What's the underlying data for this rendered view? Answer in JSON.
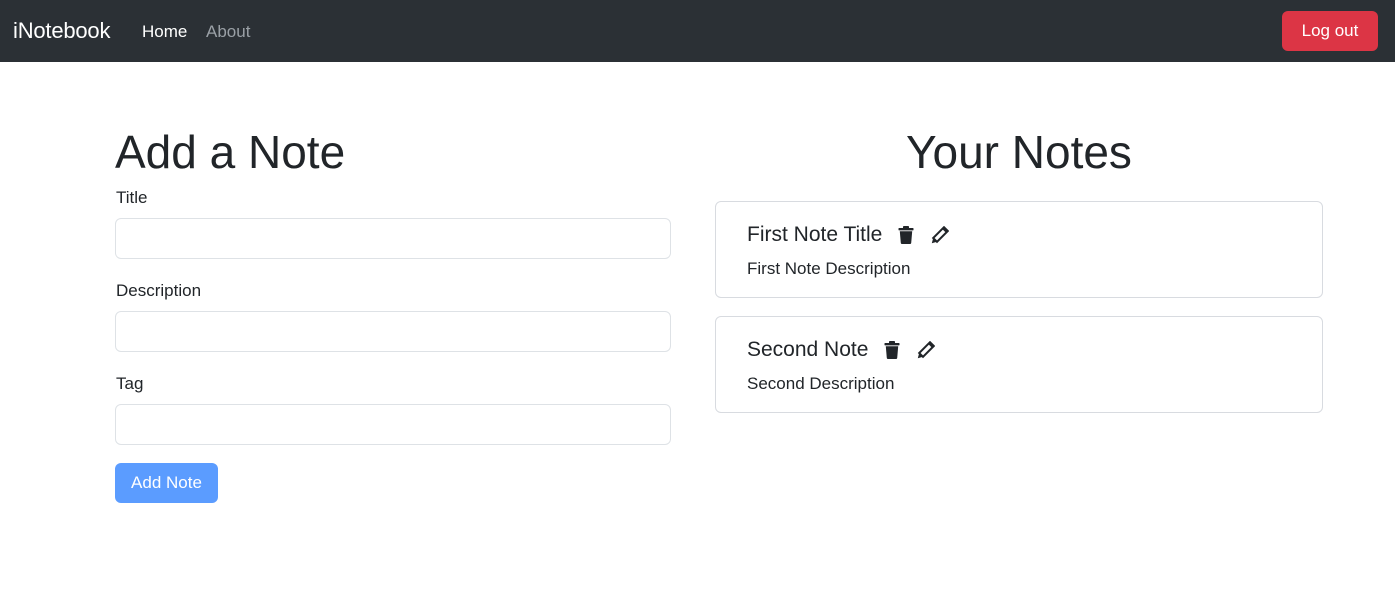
{
  "navbar": {
    "brand": "iNotebook",
    "links": [
      {
        "label": "Home"
      },
      {
        "label": "About"
      }
    ],
    "logout_label": "Log out"
  },
  "add_form": {
    "heading": "Add a Note",
    "fields": [
      {
        "label": "Title",
        "value": "",
        "placeholder": ""
      },
      {
        "label": "Description",
        "value": "",
        "placeholder": ""
      },
      {
        "label": "Tag",
        "value": "",
        "placeholder": ""
      }
    ],
    "submit_label": "Add Note"
  },
  "notes": {
    "heading": "Your Notes",
    "items": [
      {
        "title": "First Note Title",
        "description": "First Note Description",
        "icons": [
          "trash-icon",
          "pencil-icon"
        ]
      },
      {
        "title": "Second Note",
        "description": "Second Description",
        "icons": [
          "trash-icon",
          "pencil-icon"
        ]
      }
    ]
  },
  "colors": {
    "navbar_bg": "#2b3035",
    "logout_bg": "#dc3545",
    "add_button_bg": "#5b9cff"
  }
}
